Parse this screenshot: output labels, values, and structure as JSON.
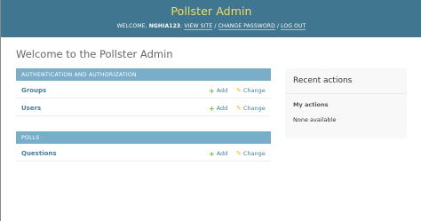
{
  "header": {
    "site_title": "Pollster Admin",
    "welcome_prefix": "Welcome,",
    "username": "nghia123",
    "view_site": "View site",
    "change_password": "Change password",
    "log_out": "Log out",
    "separator": "/"
  },
  "main": {
    "title": "Welcome to the Pollster Admin"
  },
  "apps": [
    {
      "caption": "Authentication and Authorization",
      "models": [
        {
          "name": "Groups",
          "add": "Add",
          "change": "Change"
        },
        {
          "name": "Users",
          "add": "Add",
          "change": "Change"
        }
      ]
    },
    {
      "caption": "Polls",
      "models": [
        {
          "name": "Questions",
          "add": "Add",
          "change": "Change"
        }
      ]
    }
  ],
  "recent_actions": {
    "title": "Recent actions",
    "subtitle": "My actions",
    "empty_text": "None available"
  },
  "icons": {
    "add": "plus-icon",
    "change": "pencil-icon"
  },
  "colors": {
    "header_bg": "#417690",
    "site_title": "#f5dd5d",
    "module_caption_bg": "#79aec8",
    "link": "#447e9b",
    "add_icon": "#70bf2b",
    "change_icon": "#efb80b"
  }
}
